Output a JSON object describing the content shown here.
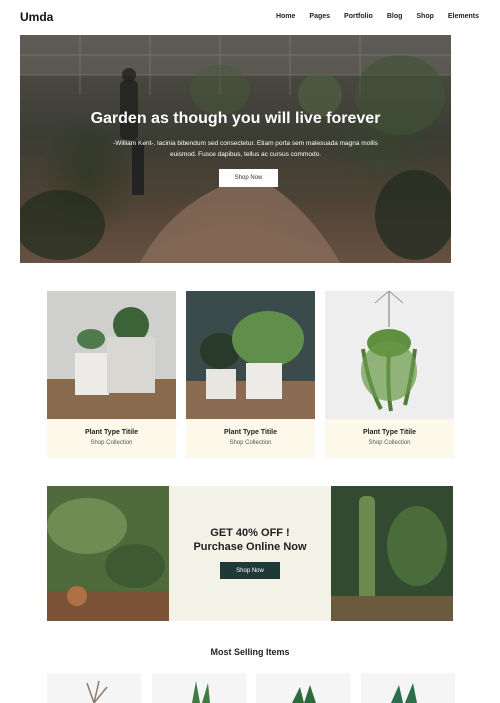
{
  "header": {
    "logo": "Umda",
    "nav": [
      "Home",
      "Pages",
      "Portfolio",
      "Blog",
      "Shop",
      "Elements"
    ]
  },
  "hero": {
    "title": "Garden as though you will live forever",
    "text": "-William Kent-. lacinia bibendum sed consectetur. Etiam porta sem malesuada magna mollis euismod. Fusce dapibus, tellus ac cursus commodo.",
    "button": "Shop Now"
  },
  "cards": [
    {
      "title": "Plant Type Titile",
      "subtitle": "Shop Collection"
    },
    {
      "title": "Plant Type Titile",
      "subtitle": "Shop Collection"
    },
    {
      "title": "Plant Type Titile",
      "subtitle": "Shop Collection"
    }
  ],
  "promo": {
    "line1": "GET 40% OFF !",
    "line2": "Purchase Online  Now",
    "button": "Shop Now"
  },
  "most_selling": {
    "title": "Most Selling Items"
  },
  "colors": {
    "accent_dark": "#1f3a36",
    "card_caption_bg": "#fcf9ea",
    "promo_bg": "#f3f2e6"
  }
}
